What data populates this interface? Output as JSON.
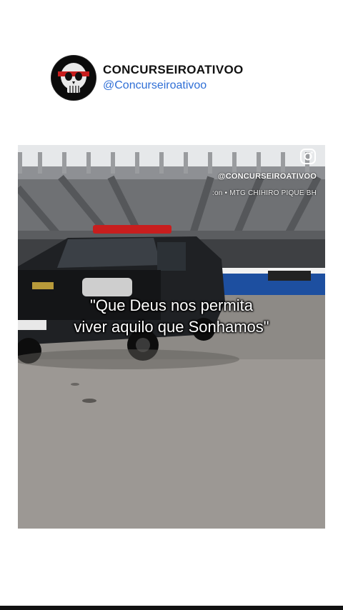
{
  "post": {
    "account_name": "CONCURSEIROATIVOO",
    "handle": "@Concurseiroativoo"
  },
  "media": {
    "watermark": "@CONCURSEIROATIVOO",
    "music_line": ":on • MTG CHIHIRO PIQUE BH",
    "caption_line1": "\"Que Deus nos permita",
    "caption_line2": "viver aquilo que Sonhamos\"",
    "icon": "instagram-icon"
  },
  "colors": {
    "handle": "#2f6fd6",
    "lightbar_red": "#d11b1b"
  }
}
